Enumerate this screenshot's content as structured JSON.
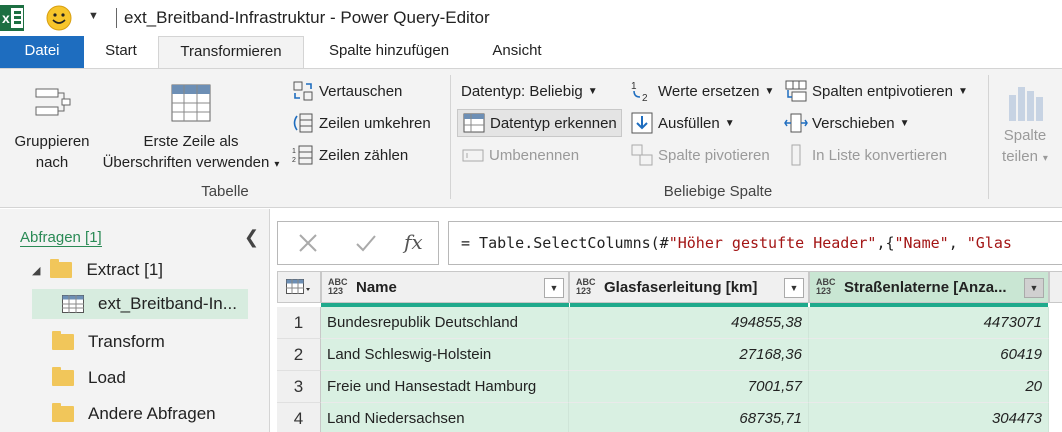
{
  "window": {
    "title": "ext_Breitband-Infrastruktur - Power Query-Editor",
    "accent": "#1e6dbf"
  },
  "tabs": [
    "Datei",
    "Start",
    "Transformieren",
    "Spalte hinzufügen",
    "Ansicht"
  ],
  "active_tab": "Transformieren",
  "ribbon": {
    "tabelle": {
      "group": "Tabelle",
      "group_by_line1": "Gruppieren",
      "group_by_line2": "nach",
      "first_row_line1": "Erste Zeile als",
      "first_row_line2": "Überschriften verwenden",
      "transpose": "Vertauschen",
      "reverse_rows": "Zeilen umkehren",
      "count_rows": "Zeilen zählen"
    },
    "any_column": {
      "group": "Beliebige Spalte",
      "data_type": "Datentyp: Beliebig",
      "detect_type": "Datentyp erkennen",
      "rename": "Umbenennen",
      "replace_values": "Werte ersetzen",
      "fill": "Ausfüllen",
      "pivot_column": "Spalte pivotieren",
      "unpivot": "Spalten entpivotieren",
      "move": "Verschieben",
      "to_list": "In Liste konvertieren"
    },
    "split": {
      "line1": "Spalte",
      "line2": "teilen"
    }
  },
  "nav": {
    "header": "Abfragen [1]",
    "items": [
      {
        "label": "Extract [1]",
        "icon": "folder-icon"
      },
      {
        "label": "ext_Breitband-In...",
        "icon": "table-icon"
      },
      {
        "label": "Transform",
        "icon": "folder-icon"
      },
      {
        "label": "Load",
        "icon": "folder-icon"
      },
      {
        "label": "Andere Abfragen",
        "icon": "folder-icon"
      }
    ]
  },
  "formula_bar": {
    "prefix": "= Table.SelectColumns(#",
    "string1": "\"Höher gestufte Header\"",
    "mid": ",{",
    "string2": "\"Name\"",
    "sep": ", ",
    "string3": "\"Glas"
  },
  "table": {
    "type_label": "ABC 123",
    "columns": [
      "Name",
      "Glasfaserleitung [km]",
      "Straßenlaterne [Anza..."
    ],
    "rows": [
      {
        "n": "1",
        "name": "Bundesrepublik Deutschland",
        "glas": "494855,38",
        "strassen": "4473071"
      },
      {
        "n": "2",
        "name": "Land Schleswig-Holstein",
        "glas": "27168,36",
        "strassen": "60419"
      },
      {
        "n": "3",
        "name": "Freie und Hansestadt Hamburg",
        "glas": "7001,57",
        "strassen": "20"
      },
      {
        "n": "4",
        "name": "Land Niedersachsen",
        "glas": "68735,71",
        "strassen": "304473"
      }
    ]
  }
}
